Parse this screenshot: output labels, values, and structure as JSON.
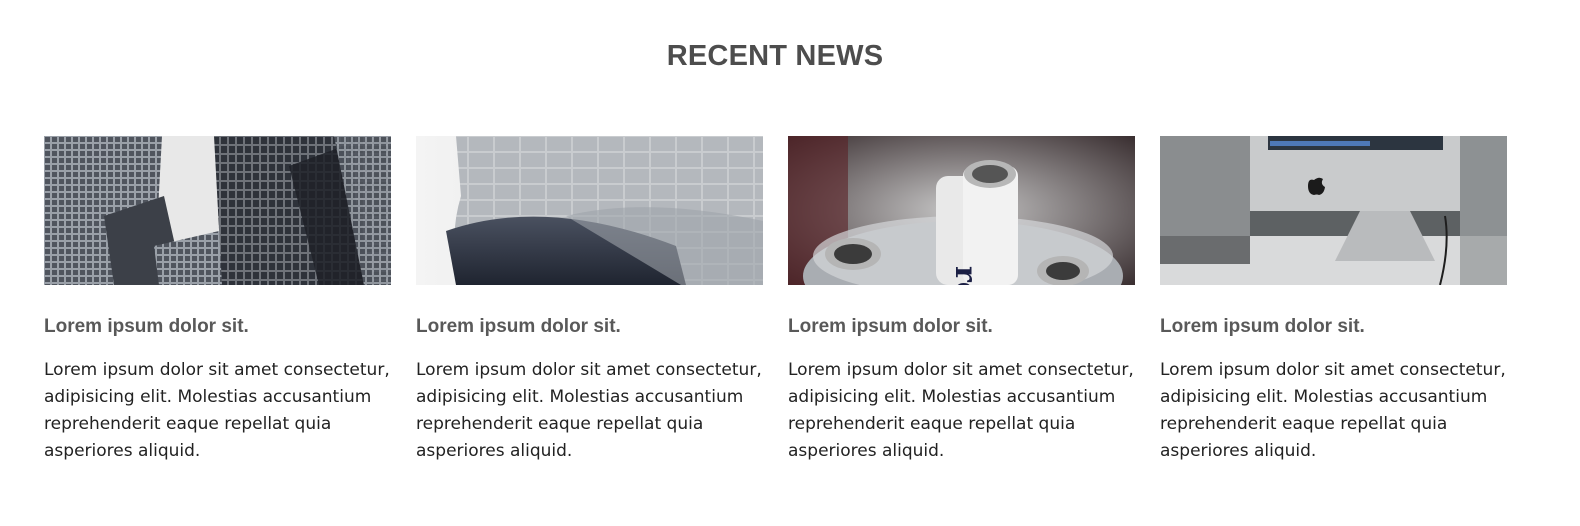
{
  "section": {
    "title": "RECENT NEWS"
  },
  "cards": [
    {
      "image": "skyscrapers-photo",
      "title": "Lorem ipsum dolor sit.",
      "text": "Lorem ipsum dolor sit amet consectetur, adipisicing elit. Molestias accusantium reprehenderit eaque repellat quia asperiores aliquid."
    },
    {
      "image": "curved-building-photo",
      "title": "Lorem ipsum dolor sit.",
      "text": "Lorem ipsum dolor sit amet consectetur, adipisicing elit. Molestias accusantium reprehenderit eaque repellat quia asperiores aliquid."
    },
    {
      "image": "bottles-in-bucket-photo",
      "title": "Lorem ipsum dolor sit.",
      "text": "Lorem ipsum dolor sit amet consectetur, adipisicing elit. Molestias accusantium reprehenderit eaque repellat quia asperiores aliquid."
    },
    {
      "image": "imac-desk-photo",
      "title": "Lorem ipsum dolor sit.",
      "text": "Lorem ipsum dolor sit amet consectetur, adipisicing elit. Molestias accusantium reprehenderit eaque repellat quia asperiores aliquid."
    }
  ]
}
